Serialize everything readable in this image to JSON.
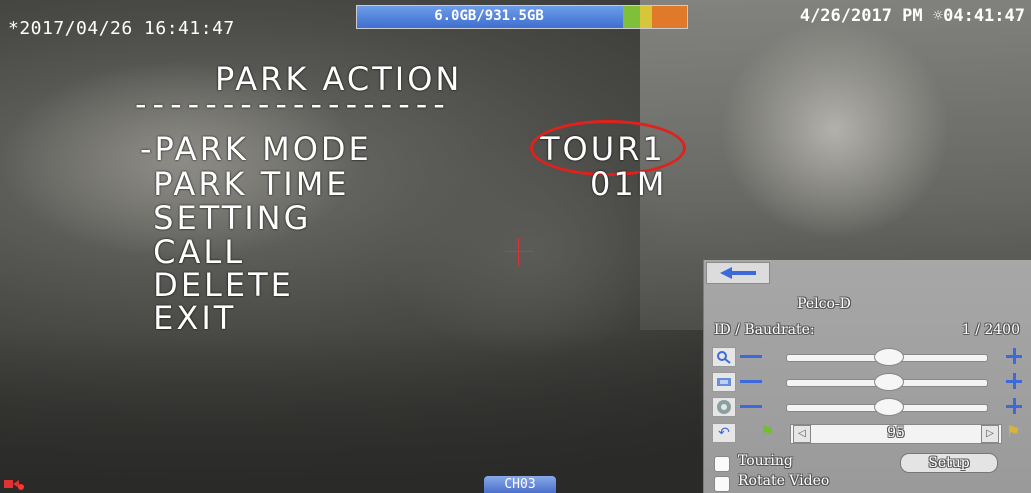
{
  "status_bar": {
    "timestamp_left": "*2017/04/26 16:41:47",
    "hdd_usage": "6.0GB/931.5GB",
    "datetime_right": "4/26/2017 PM ☼04:41:47"
  },
  "osd_menu": {
    "title": "PARK ACTION",
    "divider": "------------------",
    "items": [
      {
        "label": "-PARK MODE",
        "value": "TOUR1"
      },
      {
        "label": " PARK TIME",
        "value": "01M"
      },
      {
        "label": " SETTING",
        "value": ""
      },
      {
        "label": " CALL",
        "value": ""
      },
      {
        "label": " DELETE",
        "value": ""
      },
      {
        "label": " EXIT",
        "value": ""
      }
    ]
  },
  "ptz_panel": {
    "protocol": "Pelco-D",
    "id_baud_label": "ID / Baudrate:",
    "id_baud_value": "1 / 2400",
    "sliders": [
      {
        "icon": "zoom-icon",
        "level": 0.55
      },
      {
        "icon": "focus-icon",
        "level": 0.55
      },
      {
        "icon": "iris-icon",
        "level": 0.55
      }
    ],
    "preset_value": "95",
    "touring_label": "Touring",
    "setup_label": "Setup",
    "rotate_label": "Rotate Video"
  },
  "channel_tag": "CH03",
  "colors": {
    "accent_blue": "#3c6ad8",
    "highlight_red": "#e0211c",
    "panel_gray": "#a0a0a0"
  }
}
